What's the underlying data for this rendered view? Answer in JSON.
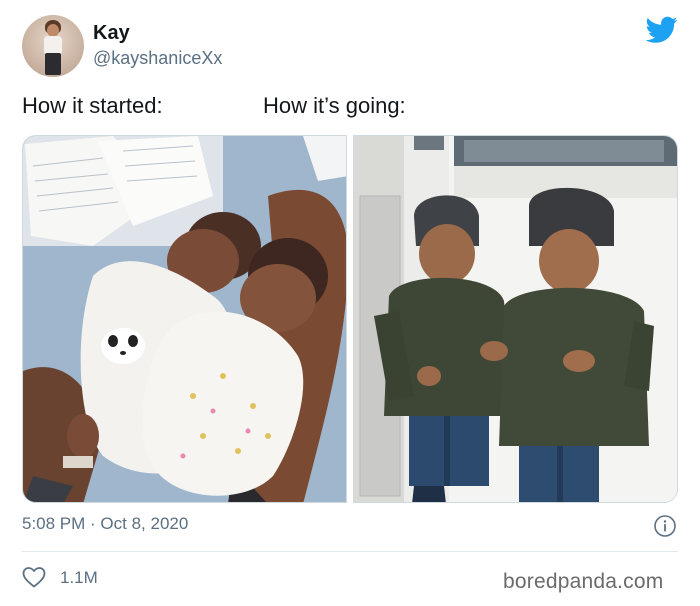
{
  "tweet": {
    "display_name": "Kay",
    "handle": "@kayshaniceXx",
    "caption_left": "How it started:",
    "caption_right": "How it’s going:",
    "timestamp": "5:08 PM · Oct 8, 2020",
    "like_count": "1.1M"
  },
  "icons": {
    "brand": "twitter-bird-icon",
    "info": "info-icon",
    "like": "heart-icon"
  },
  "colors": {
    "twitter_blue": "#1da1f2",
    "secondary_text": "#5b7083",
    "divider": "#e1e8ed"
  },
  "watermark": "boredpanda.com"
}
